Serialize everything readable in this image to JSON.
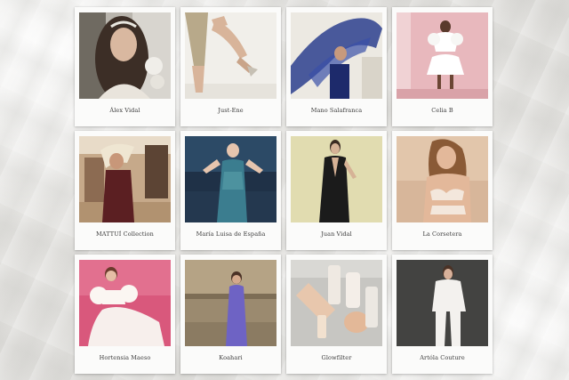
{
  "brands": [
    {
      "name": "Álex Vidal",
      "photo": "model-portrait-photo"
    },
    {
      "name": "Just-Ene",
      "photo": "legs-heels-photo"
    },
    {
      "name": "Mano Salafranca",
      "photo": "blue-tulle-photo"
    },
    {
      "name": "Celia B",
      "photo": "white-ruffle-outfit-photo"
    },
    {
      "name": "MATTUÍ Collection",
      "photo": "burgundy-dress-photo"
    },
    {
      "name": "María Luisa de España",
      "photo": "blue-lace-dress-photo"
    },
    {
      "name": "Juan Vidal",
      "photo": "black-gown-photo"
    },
    {
      "name": "La Corsetera",
      "photo": "lingerie-photo"
    },
    {
      "name": "Hortensia Maeso",
      "photo": "white-puff-dress-photo"
    },
    {
      "name": "Koahari",
      "photo": "purple-dress-photo"
    },
    {
      "name": "Glowfilter",
      "photo": "cosmetics-products-photo"
    },
    {
      "name": "Artóla Couture",
      "photo": "white-suit-photo"
    }
  ]
}
